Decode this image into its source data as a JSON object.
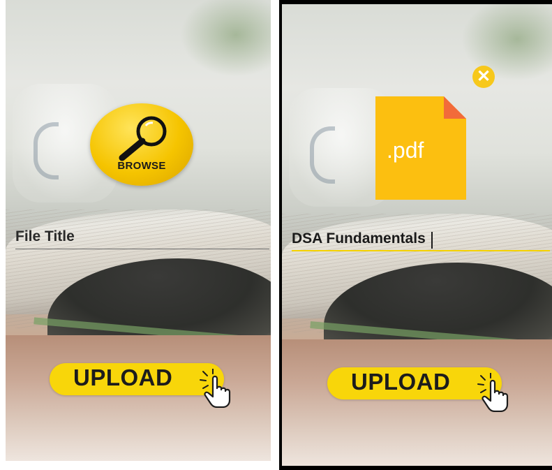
{
  "left_screen": {
    "browse_label": "BROWSE",
    "title_field": {
      "value": "File Title"
    },
    "upload_label": "UPLOAD"
  },
  "right_screen": {
    "pdf_label": ".pdf",
    "close_glyph": "✕",
    "title_field": {
      "value": "DSA Fundamentals"
    },
    "upload_label": "UPLOAD"
  },
  "colors": {
    "accent_yellow": "#f8d60a",
    "pdf_orange": "#fcbf10",
    "pdf_fold": "#f26b3a"
  }
}
